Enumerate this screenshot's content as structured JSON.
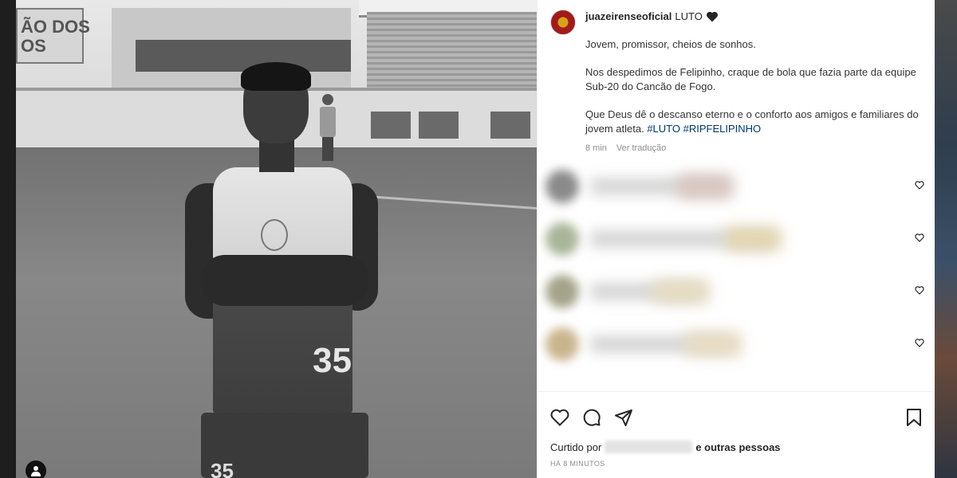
{
  "post": {
    "username": "juazeirenseoficial",
    "title": "LUTO",
    "paragraphs": [
      "Jovem, promissor, cheios de sonhos.",
      "Nos despedimos de Felipinho, craque de bola que fazia parte da equipe Sub-20 do Cancão de Fogo.",
      "Que Deus dê o descanso eterno e o conforto aos amigos e familiares do jovem atleta."
    ],
    "hashtags": "#LUTO #RIPFELIPINHO",
    "time": "8 min",
    "translate_link": "Ver tradução"
  },
  "photo": {
    "sign_text": "ÃO DOS\nOS",
    "jersey_number": "35",
    "shorts_number": "35"
  },
  "likes": {
    "prefix": "Curtido por",
    "suffix": "e outras pessoas"
  },
  "timestamp": "HÁ 8 MINUTOS",
  "colors": {
    "hashtag": "#00376b",
    "meta": "#8e8e8e",
    "text": "#262626"
  },
  "icons": [
    "heart-icon",
    "comment-icon",
    "share-icon",
    "bookmark-icon",
    "user-tag-icon"
  ]
}
